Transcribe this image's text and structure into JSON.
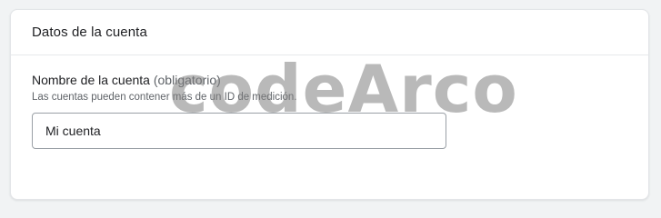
{
  "card": {
    "title": "Datos de la cuenta"
  },
  "account_name_field": {
    "label": "Nombre de la cuenta",
    "optional_note": "(obligatorio)",
    "help_text": "Las cuentas pueden contener más de un ID de medición.",
    "value": "Mi cuenta"
  },
  "watermark": {
    "text": "codeArco"
  }
}
